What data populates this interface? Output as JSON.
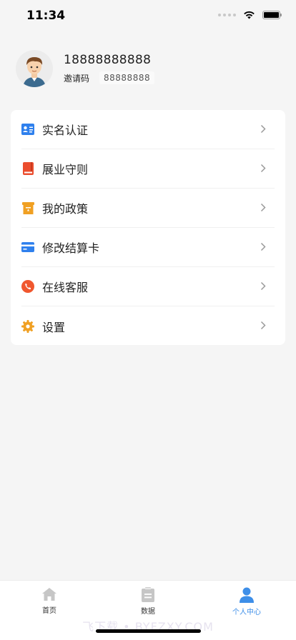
{
  "status": {
    "time": "11:34"
  },
  "profile": {
    "phone": "18888888888",
    "invite_label": "邀请码",
    "invite_code": "88888888"
  },
  "menu": [
    {
      "label": "实名认证",
      "icon": "id-card-icon",
      "color": "#2f80ed"
    },
    {
      "label": "展业守则",
      "icon": "book-icon",
      "color": "#eb4d2e"
    },
    {
      "label": "我的政策",
      "icon": "policy-icon",
      "color": "#f0a023"
    },
    {
      "label": "修改结算卡",
      "icon": "bank-card-icon",
      "color": "#2f80ed"
    },
    {
      "label": "在线客服",
      "icon": "phone-icon",
      "color": "#f0572e"
    },
    {
      "label": "设置",
      "icon": "gear-icon",
      "color": "#f0a023"
    }
  ],
  "tabbar": [
    {
      "label": "首页",
      "icon": "home-icon"
    },
    {
      "label": "数据",
      "icon": "clipboard-icon"
    },
    {
      "label": "个人中心",
      "icon": "person-icon",
      "active": true
    }
  ],
  "watermark": "飞下载 • BYFZXY.COM",
  "colors": {
    "accent": "#3d8ee8",
    "background": "#f5f5f5"
  }
}
